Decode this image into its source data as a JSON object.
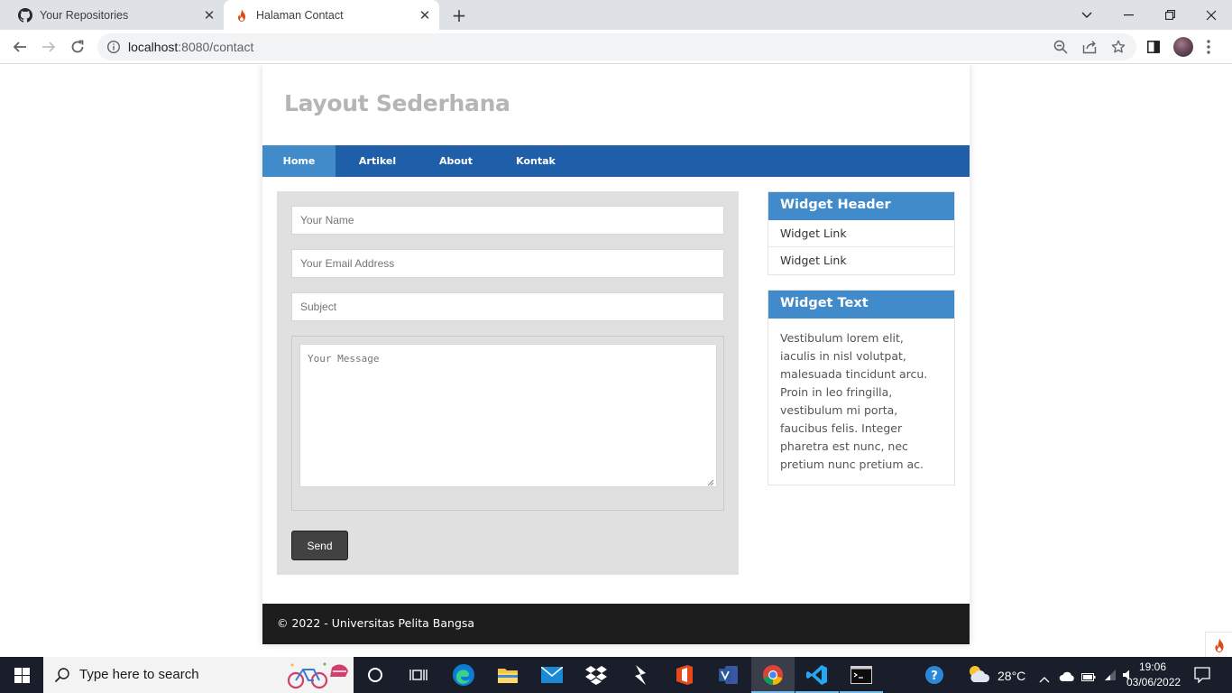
{
  "browser": {
    "tabs": [
      {
        "title": "Your Repositories",
        "icon": "github-icon",
        "active": false
      },
      {
        "title": "Halaman Contact",
        "icon": "flame-icon",
        "active": true
      }
    ],
    "url_host": "localhost",
    "url_path": ":8080/contact"
  },
  "site": {
    "title": "Layout Sederhana",
    "nav": [
      "Home",
      "Artikel",
      "About",
      "Kontak"
    ],
    "active_nav": "Home"
  },
  "form": {
    "name_placeholder": "Your Name",
    "email_placeholder": "Your Email Address",
    "subject_placeholder": "Subject",
    "message_placeholder": "Your Message",
    "send_label": "Send"
  },
  "sidebar": {
    "widget1": {
      "header": "Widget Header",
      "links": [
        "Widget Link",
        "Widget Link"
      ]
    },
    "widget2": {
      "header": "Widget Text",
      "text": "Vestibulum lorem elit, iaculis in nisl volutpat, malesuada tincidunt arcu. Proin in leo fringilla, vestibulum mi porta, faucibus felis. Integer pharetra est nunc, nec pretium nunc pretium ac."
    }
  },
  "footer": {
    "text": "© 2022 - Universitas Pelita Bangsa"
  },
  "taskbar": {
    "search_placeholder": "Type here to search",
    "weather": "28°C",
    "time": "19:06",
    "date": "03/06/2022"
  },
  "colors": {
    "nav_bg": "#1f5faa",
    "nav_active": "#428bca",
    "widget_header": "#428bca",
    "footer_bg": "#1d1d1d",
    "form_bg": "#e0e0e0"
  }
}
